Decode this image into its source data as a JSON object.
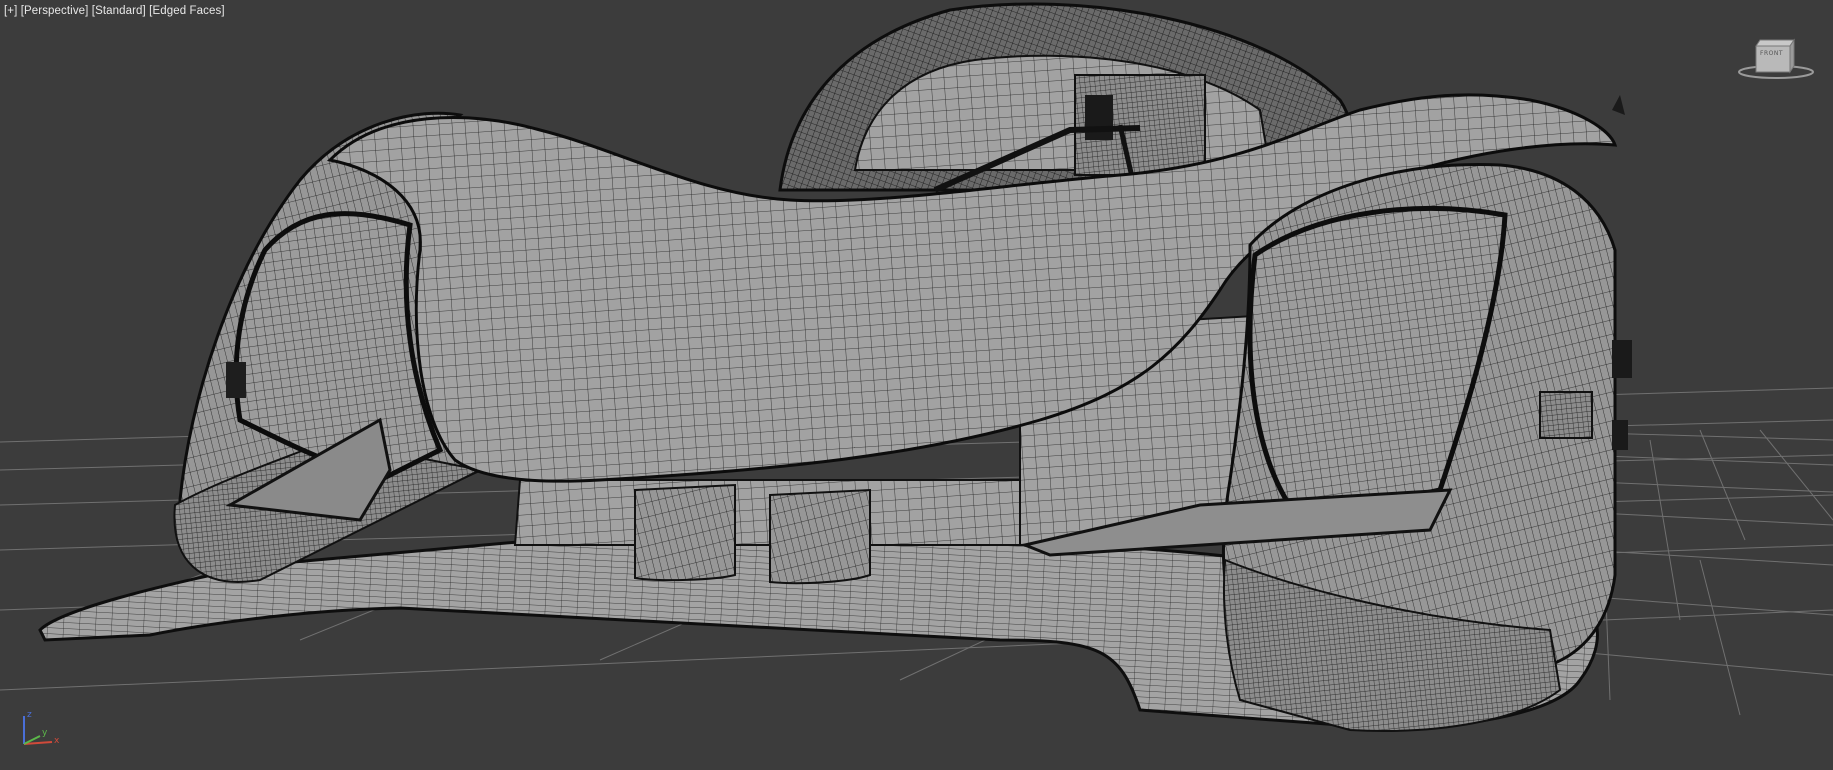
{
  "viewport": {
    "labels": [
      "[+]",
      "[Perspective]",
      "[Standard]",
      "[Edged Faces]"
    ]
  },
  "viewcube": {
    "face_label": "FRONT"
  },
  "axis_tripod": {
    "x_label": "x",
    "y_label": "y",
    "z_label": "z"
  },
  "colors": {
    "background": "#3c3c3c",
    "grid": "#6e6e6e",
    "mesh_fill": "#9a9a9a",
    "mesh_wire": "#1a1a1a",
    "axis_x": "#d04a3a",
    "axis_y": "#5cb84a",
    "axis_z": "#4a6fd8"
  }
}
